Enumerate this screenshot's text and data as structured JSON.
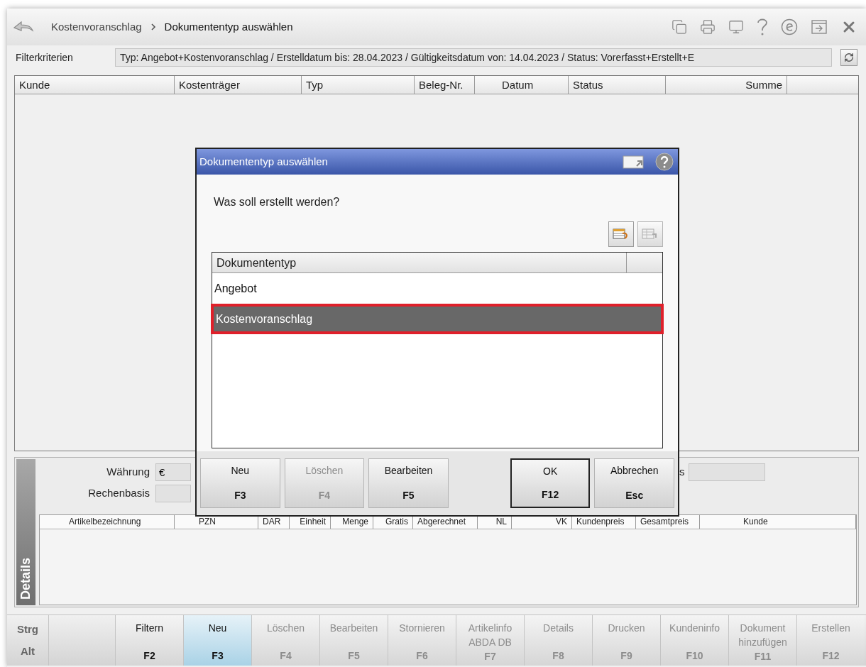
{
  "header": {
    "breadcrumb": [
      "Kostenvoranschlag",
      "Dokumententyp auswählen"
    ]
  },
  "filter": {
    "label": "Filterkriterien",
    "value": "Typ: Angebot+Kostenvoranschlag / Erstelldatum bis: 28.04.2023 / Gültigkeitsdatum von: 14.04.2023 / Status: Vorerfasst+Erstellt+E"
  },
  "main_table": {
    "columns": [
      {
        "label": "Kunde"
      },
      {
        "label": "Kostenträger"
      },
      {
        "label": "Typ"
      },
      {
        "label": "Beleg-Nr."
      },
      {},
      {
        "label": "Datum"
      },
      {
        "label": "Status"
      },
      {},
      {},
      {
        "label": "Summe"
      },
      {},
      {},
      {}
    ]
  },
  "details": {
    "tab_label": "Details",
    "currency_label": "Währung",
    "currency_value": "€",
    "basis_label": "Rechenbasis",
    "hidden_label_tail": "s",
    "columns": [
      {},
      {
        "label": "Artikelbezeichnung"
      },
      {},
      {
        "label": "PZN"
      },
      {
        "label": "DAR"
      },
      {
        "label": "Einheit"
      },
      {
        "label": "Menge"
      },
      {
        "label": "Gratis"
      },
      {
        "label": "Abgerechnet"
      },
      {
        "label": "NL"
      },
      {
        "label": "VK"
      },
      {
        "label": "Kundenpreis"
      },
      {
        "label": "Gesamtpreis"
      },
      {},
      {},
      {
        "label": "Kunde"
      }
    ]
  },
  "function_keys": {
    "modifiers": [
      "Strg",
      "Alt"
    ],
    "keys": [
      {
        "label": "Filtern",
        "key": "F2",
        "disabled": false,
        "selected": false
      },
      {
        "label": "Neu",
        "key": "F3",
        "disabled": false,
        "selected": true
      },
      {
        "label": "Löschen",
        "key": "F4",
        "disabled": true,
        "selected": false
      },
      {
        "label": "Bearbeiten",
        "key": "F5",
        "disabled": true,
        "selected": false
      },
      {
        "label": "Stornieren",
        "key": "F6",
        "disabled": true,
        "selected": false
      },
      {
        "label": "Artikelinfo ABDA DB",
        "key": "F7",
        "disabled": true,
        "selected": false
      },
      {
        "label": "Details",
        "key": "F8",
        "disabled": true,
        "selected": false
      },
      {
        "label": "Drucken",
        "key": "F9",
        "disabled": true,
        "selected": false
      },
      {
        "label": "Kundeninfo",
        "key": "F10",
        "disabled": true,
        "selected": false
      },
      {
        "label": "Dokument hinzufügen",
        "key": "F11",
        "disabled": true,
        "selected": false
      },
      {
        "label": "Erstellen",
        "key": "F12",
        "disabled": true,
        "selected": false
      }
    ]
  },
  "dialog": {
    "title": "Dokumententyp auswählen",
    "prompt": "Was soll erstellt werden?",
    "list_header": "Dokumententyp",
    "rows": [
      {
        "label": "Angebot",
        "selected": false
      },
      {
        "label": "Kostenvoranschlag",
        "selected": true
      }
    ],
    "buttons": [
      {
        "label": "Neu",
        "key": "F3",
        "disabled": false,
        "default": false
      },
      {
        "label": "Löschen",
        "key": "F4",
        "disabled": true,
        "default": false
      },
      {
        "label": "Bearbeiten",
        "key": "F5",
        "disabled": false,
        "default": false
      },
      {
        "label": "OK",
        "key": "F12",
        "disabled": false,
        "default": true
      },
      {
        "label": "Abbrechen",
        "key": "Esc",
        "disabled": false,
        "default": false
      }
    ]
  }
}
